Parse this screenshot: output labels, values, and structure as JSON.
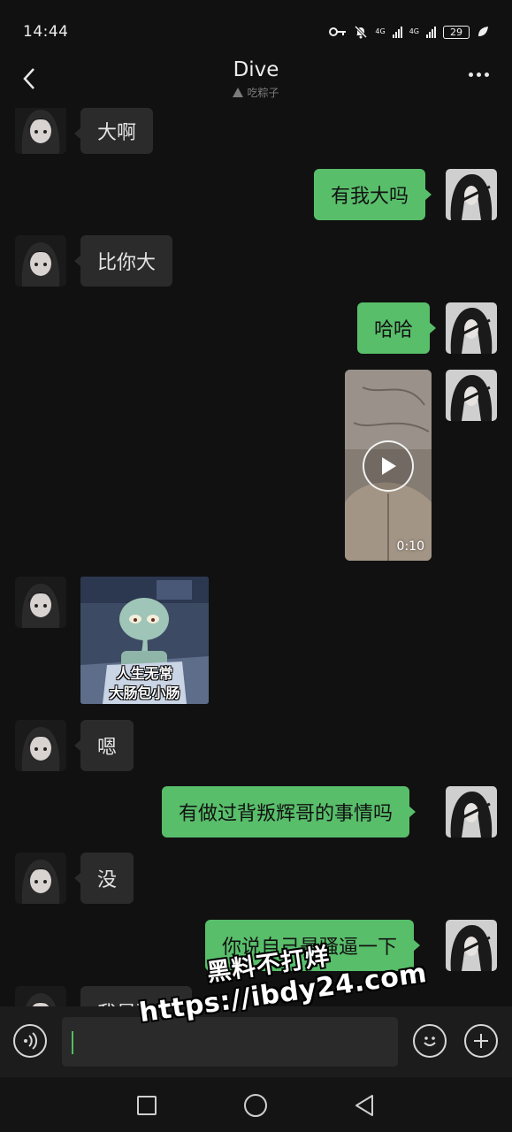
{
  "status_bar": {
    "time": "14:44",
    "net1": "4G",
    "net2": "4G",
    "battery": "29"
  },
  "header": {
    "title": "Dive",
    "subtitle": "吃粽子"
  },
  "messages": [
    {
      "side": "in",
      "type": "text",
      "text": "大啊"
    },
    {
      "side": "out",
      "type": "text",
      "text": "有我大吗"
    },
    {
      "side": "in",
      "type": "text",
      "text": "比你大"
    },
    {
      "side": "out",
      "type": "text",
      "text": "哈哈"
    },
    {
      "side": "out",
      "type": "video",
      "duration": "0:10"
    },
    {
      "side": "in",
      "type": "sticker",
      "caption_line1": "人生无常",
      "caption_line2": "大肠包小肠"
    },
    {
      "side": "in",
      "type": "text",
      "text": "嗯"
    },
    {
      "side": "out",
      "type": "text",
      "text": "有做过背叛辉哥的事情吗"
    },
    {
      "side": "in",
      "type": "text",
      "text": "没"
    },
    {
      "side": "out",
      "type": "text",
      "text": "你说自己是骚逼一下"
    },
    {
      "side": "in",
      "type": "text",
      "text": "我是骚逼"
    }
  ],
  "input": {
    "placeholder": ""
  },
  "watermark": {
    "line1": "黑料不打烊",
    "line2": "https://ibdy24.com"
  },
  "icons": {
    "back": "chevron-left-icon",
    "more": "more-dots-icon",
    "voice": "voice-icon",
    "emoji": "emoji-icon",
    "plus": "plus-icon",
    "play": "play-icon",
    "nav_recent": "square-icon",
    "nav_home": "circle-icon",
    "nav_back": "triangle-back-icon"
  },
  "colors": {
    "background": "#111111",
    "bubble_out": "#58be6a",
    "bubble_in": "#2b2b2b"
  }
}
